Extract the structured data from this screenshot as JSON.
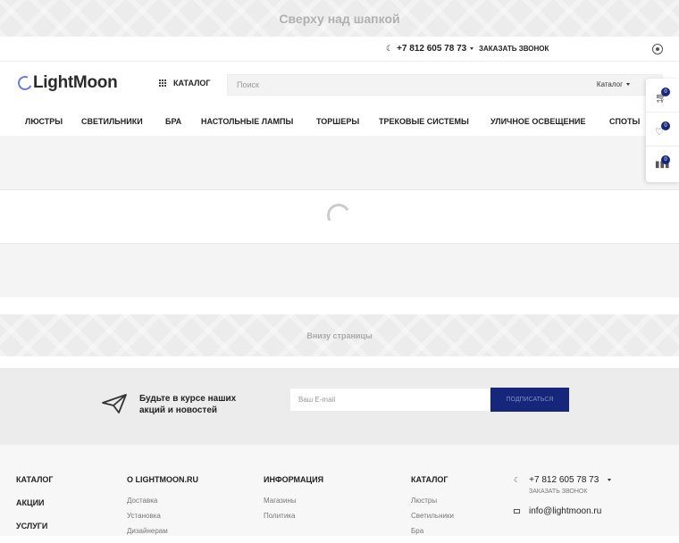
{
  "topbar": {
    "text": "Сверху над шапкой"
  },
  "contacts": {
    "phone": "+7 812 605 78 73",
    "callback": "ЗАКАЗАТЬ ЗВОНОК"
  },
  "header": {
    "logo": "LightMoon",
    "catalog_label": "КАТАЛОГ",
    "search_placeholder": "Поиск",
    "search_category": "Каталог"
  },
  "nav": {
    "items": [
      {
        "label": "ЛЮСТРЫ"
      },
      {
        "label": "СВЕТИЛЬНИКИ"
      },
      {
        "label": "БРА"
      },
      {
        "label": "НАСТОЛЬНЫЕ ЛАМПЫ"
      },
      {
        "label": "ТОРШЕРЫ"
      },
      {
        "label": "ТРЕКОВЫЕ СИСТЕМЫ"
      },
      {
        "label": "УЛИЧНОЕ ОСВЕЩЕНИЕ"
      },
      {
        "label": "СПОТЫ"
      }
    ]
  },
  "side_panel": {
    "cart_count": "0",
    "wishlist_count": "0",
    "compare_count": "0"
  },
  "bottombar": {
    "text": "Внизу страницы"
  },
  "subscribe": {
    "text_line1": "Будьте в курсе наших",
    "text_line2": "акций и новостей",
    "email_placeholder": "Ваш E-mail",
    "button": "подписаться"
  },
  "footer": {
    "col1": [
      "КАТАЛОГ",
      "АКЦИИ",
      "УСЛУГИ"
    ],
    "col2": {
      "title": "О LIGHTMOON.RU",
      "links": [
        "Доставка",
        "Установка",
        "Дизайнерам"
      ]
    },
    "col3": {
      "title": "ИНФОРМАЦИЯ",
      "links": [
        "Магазины",
        "Политика"
      ]
    },
    "col4": {
      "title": "КАТАЛОГ",
      "links": [
        "Люстры",
        "Светильники",
        "Бра"
      ]
    },
    "phone": "+7 812 605 78 73",
    "callback": "ЗАКАЗАТЬ ЗВОНОК",
    "email": "info@lightmoon.ru"
  },
  "colors": {
    "accent": "#16267a",
    "logo_moon": "#6b7bd6"
  }
}
